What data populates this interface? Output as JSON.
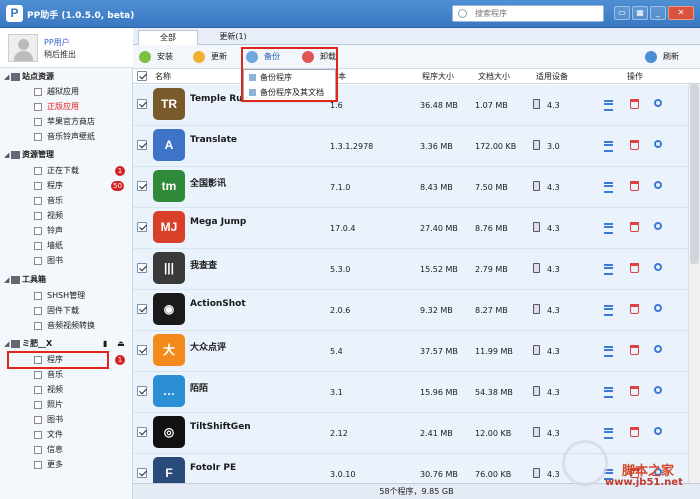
{
  "window": {
    "title": "PP助手 (1.0.5.0, beta)",
    "search_placeholder": "搜索程序"
  },
  "user": {
    "name": "PP用户",
    "logout": "稍后推出"
  },
  "sidebar": {
    "groups": [
      {
        "label": "站点资源",
        "items": [
          "越狱应用",
          "正版应用",
          "苹果官方商店",
          "音乐铃声壁纸"
        ]
      },
      {
        "label": "资源管理",
        "items": [
          "正在下载",
          "程序",
          "音乐",
          "视频",
          "铃声",
          "墙纸",
          "图书"
        ]
      },
      {
        "label": "工具箱",
        "items": [
          "SHSH管理",
          "固件下载",
          "音频视频转换"
        ]
      },
      {
        "label": "ミ肥__X",
        "items": [
          "程序",
          "音乐",
          "视频",
          "照片",
          "图书",
          "文件",
          "信息",
          "更多"
        ]
      }
    ],
    "badges": {
      "downloading": "1",
      "programs": "50",
      "device_programs": "1"
    }
  },
  "tabs": [
    "全部",
    "更新(1)"
  ],
  "toolbar": {
    "install": "安装",
    "update": "更新",
    "backup": "备份",
    "uninstall": "卸载",
    "refresh": "刷新"
  },
  "backup_menu": [
    "备份程序",
    "备份程序及其文档"
  ],
  "columns": {
    "name": "名称",
    "version": "本",
    "size": "程序大小",
    "doc_size": "文档大小",
    "device": "适用设备",
    "actions": "操作"
  },
  "apps": [
    {
      "name": "Temple Run",
      "version": "1.6",
      "size": "36.48 MB",
      "doc": "1.07 MB",
      "device": "4.3",
      "color": "#7a5a2a",
      "icon_text": "TR"
    },
    {
      "name": "Translate",
      "version": "1.3.1.2978",
      "size": "3.36 MB",
      "doc": "172.00 KB",
      "device": "3.0",
      "color": "#3d74c8",
      "icon_text": "A"
    },
    {
      "name": "全国影讯",
      "version": "7.1.0",
      "size": "8.43 MB",
      "doc": "7.50 MB",
      "device": "4.3",
      "color": "#2f8a3a",
      "icon_text": "tm"
    },
    {
      "name": "Mega Jump",
      "version": "17.0.4",
      "size": "27.40 MB",
      "doc": "8.76 MB",
      "device": "4.3",
      "color": "#d8402a",
      "icon_text": "MJ"
    },
    {
      "name": "我查查",
      "version": "5.3.0",
      "size": "15.52 MB",
      "doc": "2.79 MB",
      "device": "4.3",
      "color": "#3a3a3a",
      "icon_text": "|||"
    },
    {
      "name": "ActionShot",
      "version": "2.0.6",
      "size": "9.32 MB",
      "doc": "8.27 MB",
      "device": "4.3",
      "color": "#1a1a1a",
      "icon_text": "◉"
    },
    {
      "name": "大众点评",
      "version": "5.4",
      "size": "37.57 MB",
      "doc": "11.99 MB",
      "device": "4.3",
      "color": "#f28a1c",
      "icon_text": "大"
    },
    {
      "name": "陌陌",
      "version": "3.1",
      "size": "15.96 MB",
      "doc": "54.38 MB",
      "device": "4.3",
      "color": "#2c8fd6",
      "icon_text": "…"
    },
    {
      "name": "TiltShiftGen",
      "version": "2.12",
      "size": "2.41 MB",
      "doc": "12.00 KB",
      "device": "4.3",
      "color": "#111111",
      "icon_text": "◎"
    },
    {
      "name": "FotoIr PE",
      "version": "3.0.10",
      "size": "30.76 MB",
      "doc": "76.00 KB",
      "device": "4.3",
      "color": "#2a4a7a",
      "icon_text": "F"
    }
  ],
  "status": "58个程序，9.85 GB",
  "watermark": {
    "line1": "脚本之家",
    "line2": "www.jb51.net"
  }
}
